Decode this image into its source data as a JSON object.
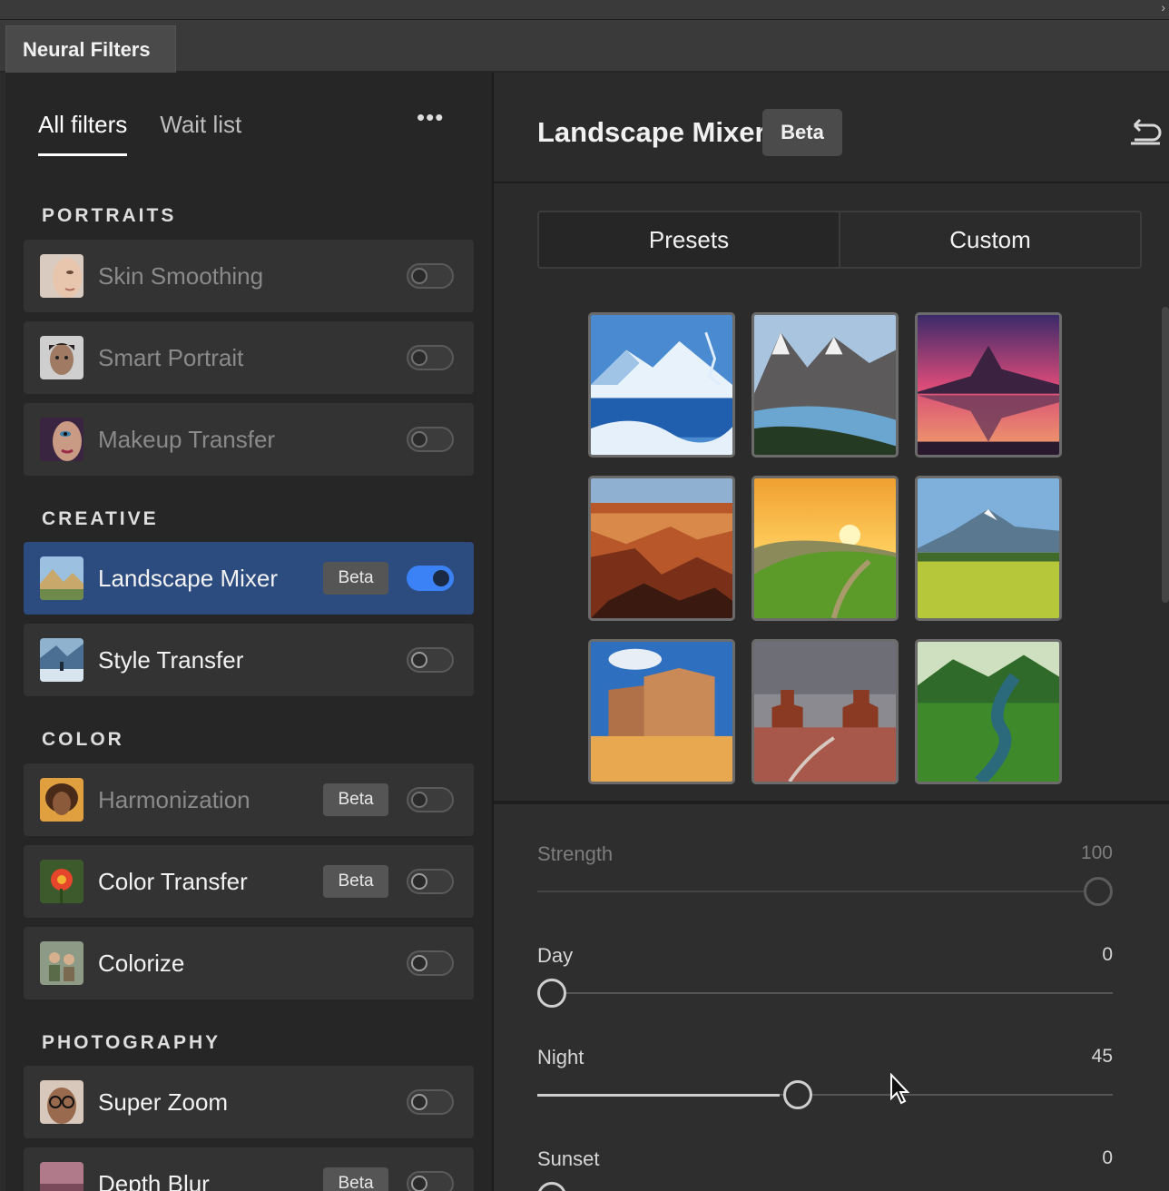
{
  "panel": {
    "title": "Neural Filters"
  },
  "left": {
    "tabs": [
      {
        "label": "All filters",
        "active": true
      },
      {
        "label": "Wait list",
        "active": false
      }
    ],
    "more_icon": "ellipsis-icon",
    "sections": {
      "portraits": "PORTRAITS",
      "creative": "CREATIVE",
      "color": "COLOR",
      "photography": "PHOTOGRAPHY"
    },
    "filters": {
      "skin_smoothing": {
        "label": "Skin Smoothing",
        "on": false
      },
      "smart_portrait": {
        "label": "Smart Portrait",
        "on": false
      },
      "makeup_transfer": {
        "label": "Makeup Transfer",
        "on": false
      },
      "landscape_mixer": {
        "label": "Landscape Mixer",
        "badge": "Beta",
        "on": true
      },
      "style_transfer": {
        "label": "Style Transfer",
        "on": false
      },
      "harmonization": {
        "label": "Harmonization",
        "badge": "Beta",
        "on": false
      },
      "color_transfer": {
        "label": "Color Transfer",
        "badge": "Beta",
        "on": false
      },
      "colorize": {
        "label": "Colorize",
        "on": false
      },
      "super_zoom": {
        "label": "Super Zoom",
        "on": false
      },
      "depth_blur": {
        "label": "Depth Blur",
        "badge": "Beta",
        "on": false
      }
    }
  },
  "right": {
    "title": "Landscape Mixer",
    "badge": "Beta",
    "reset_icon": "reset-icon",
    "segments": [
      {
        "label": "Presets",
        "active": true
      },
      {
        "label": "Custom",
        "active": false
      }
    ],
    "presets": [
      "snowy-lake-mountains",
      "alpine-valley-lake",
      "matterhorn-sunset-reflection",
      "grand-canyon",
      "green-hills-sunrise",
      "alpine-meadow",
      "desert-rock-formations",
      "monument-valley",
      "jungle-river"
    ],
    "sliders": {
      "strength": {
        "label": "Strength",
        "value": 100,
        "max": 100
      },
      "day": {
        "label": "Day",
        "value": 0,
        "max": 100
      },
      "night": {
        "label": "Night",
        "value": 45,
        "max": 100
      },
      "sunset": {
        "label": "Sunset",
        "value": 0,
        "max": 100
      }
    }
  },
  "colors": {
    "accent": "#3b82f6",
    "selected_row": "#2c4b7e",
    "panel_bg": "#262626"
  }
}
